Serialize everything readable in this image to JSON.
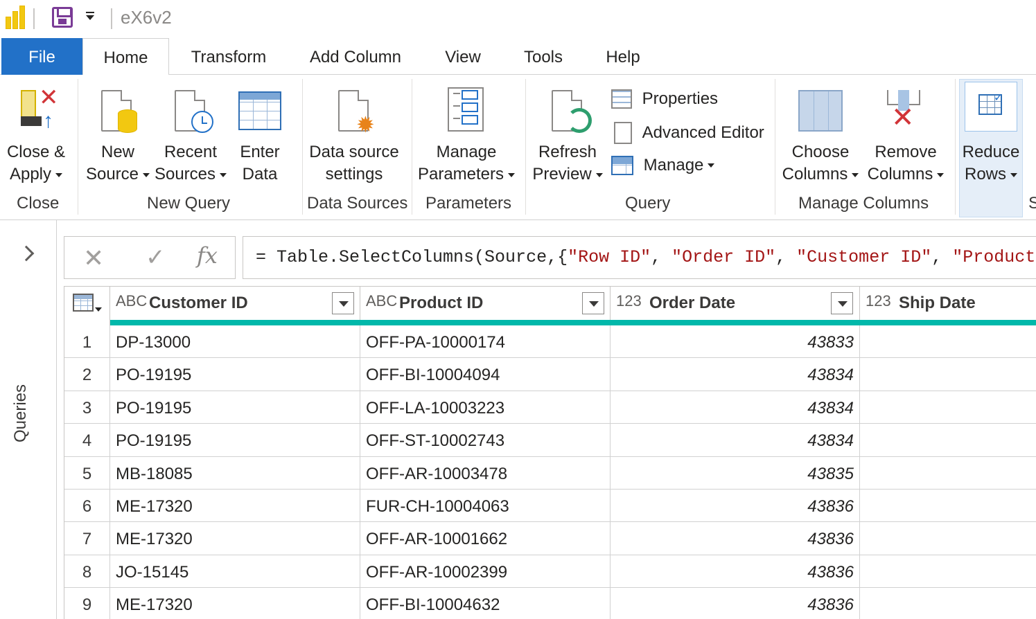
{
  "window": {
    "title": "eX6v2"
  },
  "tabs": [
    {
      "label": "File"
    },
    {
      "label": "Home"
    },
    {
      "label": "Transform"
    },
    {
      "label": "Add Column"
    },
    {
      "label": "View"
    },
    {
      "label": "Tools"
    },
    {
      "label": "Help"
    }
  ],
  "ribbon": {
    "close_apply": {
      "line1": "Close &",
      "line2": "Apply"
    },
    "new_source": {
      "line1": "New",
      "line2": "Source"
    },
    "recent_sources": {
      "line1": "Recent",
      "line2": "Sources"
    },
    "enter_data": {
      "line1": "Enter",
      "line2": "Data"
    },
    "data_source_settings": {
      "line1": "Data source",
      "line2": "settings"
    },
    "manage_parameters": {
      "line1": "Manage",
      "line2": "Parameters"
    },
    "refresh_preview": {
      "line1": "Refresh",
      "line2": "Preview"
    },
    "properties": "Properties",
    "advanced_editor": "Advanced Editor",
    "manage": "Manage",
    "choose_columns": {
      "line1": "Choose",
      "line2": "Columns"
    },
    "remove_columns": {
      "line1": "Remove",
      "line2": "Columns"
    },
    "reduce_rows": {
      "line1": "Reduce",
      "line2": "Rows"
    },
    "groups": {
      "close": "Close",
      "new_query": "New Query",
      "data_sources": "Data Sources",
      "parameters": "Parameters",
      "query": "Query",
      "manage_columns": "Manage Columns",
      "cut": "S"
    }
  },
  "left_pane": {
    "label": "Queries"
  },
  "formula_bar": {
    "fx": "fx",
    "prefix": "= Table.SelectColumns(Source,{",
    "s1": "\"Row ID\"",
    "s2": "\"Order ID\"",
    "s3": "\"Customer ID\"",
    "s4": "\"Product",
    "comma": ", "
  },
  "table": {
    "columns": [
      {
        "name": "Customer ID",
        "type": "ABC"
      },
      {
        "name": "Product ID",
        "type": "ABC"
      },
      {
        "name": "Order Date",
        "type": "123"
      },
      {
        "name": "Ship Date",
        "type": "123"
      }
    ],
    "rows": [
      {
        "idx": "1",
        "customer": "DP-13000",
        "product": "OFF-PA-10000174",
        "order_date": "43833",
        "ship_date": ""
      },
      {
        "idx": "2",
        "customer": "PO-19195",
        "product": "OFF-BI-10004094",
        "order_date": "43834",
        "ship_date": ""
      },
      {
        "idx": "3",
        "customer": "PO-19195",
        "product": "OFF-LA-10003223",
        "order_date": "43834",
        "ship_date": ""
      },
      {
        "idx": "4",
        "customer": "PO-19195",
        "product": "OFF-ST-10002743",
        "order_date": "43834",
        "ship_date": ""
      },
      {
        "idx": "5",
        "customer": "MB-18085",
        "product": "OFF-AR-10003478",
        "order_date": "43835",
        "ship_date": ""
      },
      {
        "idx": "6",
        "customer": "ME-17320",
        "product": "FUR-CH-10004063",
        "order_date": "43836",
        "ship_date": ""
      },
      {
        "idx": "7",
        "customer": "ME-17320",
        "product": "OFF-AR-10001662",
        "order_date": "43836",
        "ship_date": ""
      },
      {
        "idx": "8",
        "customer": "JO-15145",
        "product": "OFF-AR-10002399",
        "order_date": "43836",
        "ship_date": ""
      },
      {
        "idx": "9",
        "customer": "ME-17320",
        "product": "OFF-BI-10004632",
        "order_date": "43836",
        "ship_date": ""
      }
    ]
  },
  "colors": {
    "accent": "#2271c8",
    "teal": "#01b8aa",
    "string": "#a31515",
    "logo": "#f2c811",
    "save": "#7a3b96"
  }
}
